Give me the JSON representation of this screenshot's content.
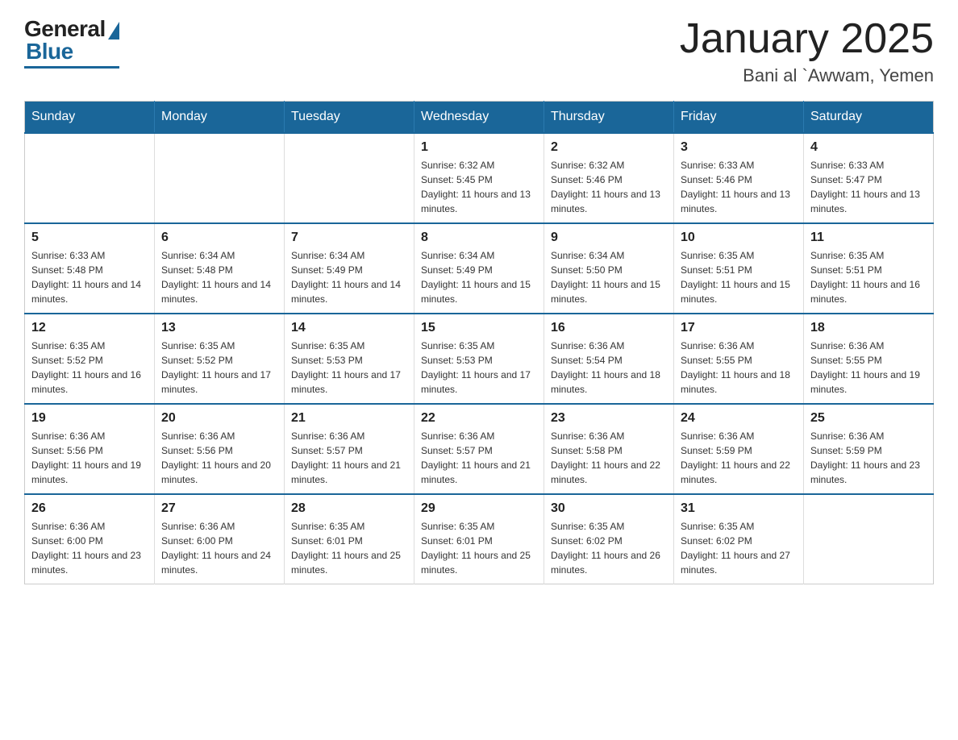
{
  "header": {
    "logo": {
      "general": "General",
      "blue": "Blue"
    },
    "title": "January 2025",
    "location": "Bani al `Awwam, Yemen"
  },
  "days_of_week": [
    "Sunday",
    "Monday",
    "Tuesday",
    "Wednesday",
    "Thursday",
    "Friday",
    "Saturday"
  ],
  "weeks": [
    [
      {
        "day": "",
        "info": ""
      },
      {
        "day": "",
        "info": ""
      },
      {
        "day": "",
        "info": ""
      },
      {
        "day": "1",
        "info": "Sunrise: 6:32 AM\nSunset: 5:45 PM\nDaylight: 11 hours and 13 minutes."
      },
      {
        "day": "2",
        "info": "Sunrise: 6:32 AM\nSunset: 5:46 PM\nDaylight: 11 hours and 13 minutes."
      },
      {
        "day": "3",
        "info": "Sunrise: 6:33 AM\nSunset: 5:46 PM\nDaylight: 11 hours and 13 minutes."
      },
      {
        "day": "4",
        "info": "Sunrise: 6:33 AM\nSunset: 5:47 PM\nDaylight: 11 hours and 13 minutes."
      }
    ],
    [
      {
        "day": "5",
        "info": "Sunrise: 6:33 AM\nSunset: 5:48 PM\nDaylight: 11 hours and 14 minutes."
      },
      {
        "day": "6",
        "info": "Sunrise: 6:34 AM\nSunset: 5:48 PM\nDaylight: 11 hours and 14 minutes."
      },
      {
        "day": "7",
        "info": "Sunrise: 6:34 AM\nSunset: 5:49 PM\nDaylight: 11 hours and 14 minutes."
      },
      {
        "day": "8",
        "info": "Sunrise: 6:34 AM\nSunset: 5:49 PM\nDaylight: 11 hours and 15 minutes."
      },
      {
        "day": "9",
        "info": "Sunrise: 6:34 AM\nSunset: 5:50 PM\nDaylight: 11 hours and 15 minutes."
      },
      {
        "day": "10",
        "info": "Sunrise: 6:35 AM\nSunset: 5:51 PM\nDaylight: 11 hours and 15 minutes."
      },
      {
        "day": "11",
        "info": "Sunrise: 6:35 AM\nSunset: 5:51 PM\nDaylight: 11 hours and 16 minutes."
      }
    ],
    [
      {
        "day": "12",
        "info": "Sunrise: 6:35 AM\nSunset: 5:52 PM\nDaylight: 11 hours and 16 minutes."
      },
      {
        "day": "13",
        "info": "Sunrise: 6:35 AM\nSunset: 5:52 PM\nDaylight: 11 hours and 17 minutes."
      },
      {
        "day": "14",
        "info": "Sunrise: 6:35 AM\nSunset: 5:53 PM\nDaylight: 11 hours and 17 minutes."
      },
      {
        "day": "15",
        "info": "Sunrise: 6:35 AM\nSunset: 5:53 PM\nDaylight: 11 hours and 17 minutes."
      },
      {
        "day": "16",
        "info": "Sunrise: 6:36 AM\nSunset: 5:54 PM\nDaylight: 11 hours and 18 minutes."
      },
      {
        "day": "17",
        "info": "Sunrise: 6:36 AM\nSunset: 5:55 PM\nDaylight: 11 hours and 18 minutes."
      },
      {
        "day": "18",
        "info": "Sunrise: 6:36 AM\nSunset: 5:55 PM\nDaylight: 11 hours and 19 minutes."
      }
    ],
    [
      {
        "day": "19",
        "info": "Sunrise: 6:36 AM\nSunset: 5:56 PM\nDaylight: 11 hours and 19 minutes."
      },
      {
        "day": "20",
        "info": "Sunrise: 6:36 AM\nSunset: 5:56 PM\nDaylight: 11 hours and 20 minutes."
      },
      {
        "day": "21",
        "info": "Sunrise: 6:36 AM\nSunset: 5:57 PM\nDaylight: 11 hours and 21 minutes."
      },
      {
        "day": "22",
        "info": "Sunrise: 6:36 AM\nSunset: 5:57 PM\nDaylight: 11 hours and 21 minutes."
      },
      {
        "day": "23",
        "info": "Sunrise: 6:36 AM\nSunset: 5:58 PM\nDaylight: 11 hours and 22 minutes."
      },
      {
        "day": "24",
        "info": "Sunrise: 6:36 AM\nSunset: 5:59 PM\nDaylight: 11 hours and 22 minutes."
      },
      {
        "day": "25",
        "info": "Sunrise: 6:36 AM\nSunset: 5:59 PM\nDaylight: 11 hours and 23 minutes."
      }
    ],
    [
      {
        "day": "26",
        "info": "Sunrise: 6:36 AM\nSunset: 6:00 PM\nDaylight: 11 hours and 23 minutes."
      },
      {
        "day": "27",
        "info": "Sunrise: 6:36 AM\nSunset: 6:00 PM\nDaylight: 11 hours and 24 minutes."
      },
      {
        "day": "28",
        "info": "Sunrise: 6:35 AM\nSunset: 6:01 PM\nDaylight: 11 hours and 25 minutes."
      },
      {
        "day": "29",
        "info": "Sunrise: 6:35 AM\nSunset: 6:01 PM\nDaylight: 11 hours and 25 minutes."
      },
      {
        "day": "30",
        "info": "Sunrise: 6:35 AM\nSunset: 6:02 PM\nDaylight: 11 hours and 26 minutes."
      },
      {
        "day": "31",
        "info": "Sunrise: 6:35 AM\nSunset: 6:02 PM\nDaylight: 11 hours and 27 minutes."
      },
      {
        "day": "",
        "info": ""
      }
    ]
  ]
}
